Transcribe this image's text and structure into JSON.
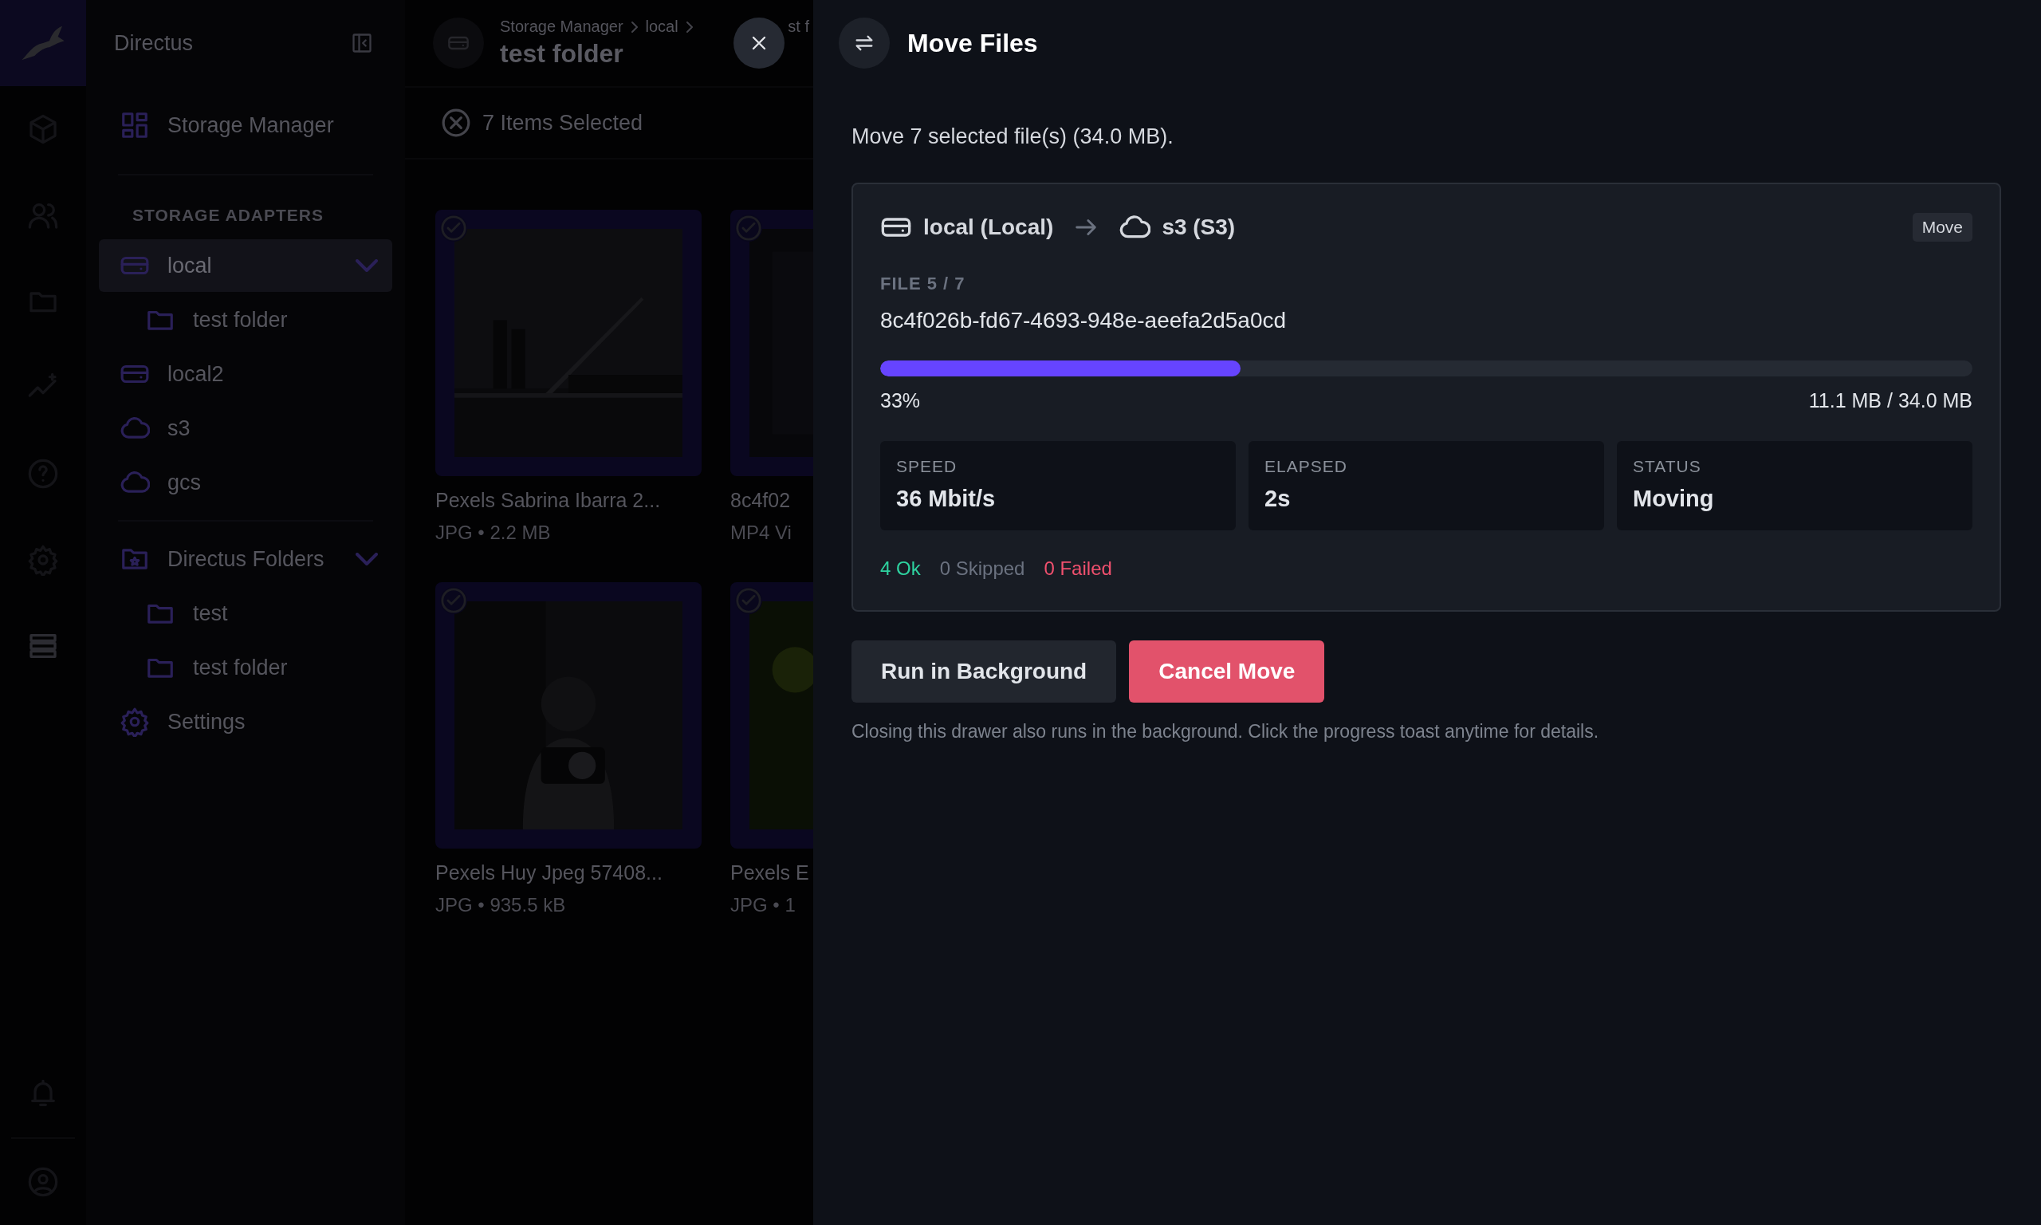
{
  "nav_rail": {
    "items": [
      {
        "selected": false
      },
      {
        "selected": false
      },
      {
        "selected": false
      },
      {
        "selected": false
      },
      {
        "selected": false
      },
      {
        "selected": false
      },
      {
        "selected": true
      }
    ],
    "bottom_items": [
      {
        "selected": false
      },
      {
        "selected": false
      }
    ]
  },
  "sidebar": {
    "title": "Directus",
    "module": {
      "label": "Storage Manager"
    },
    "adapters": {
      "heading": "STORAGE ADAPTERS",
      "items": [
        {
          "kind": "disk",
          "label": "local",
          "selected": true,
          "expanded": true,
          "children": [
            {
              "kind": "folder",
              "label": "test folder",
              "selected": false
            }
          ]
        },
        {
          "kind": "disk",
          "label": "local2",
          "selected": false
        },
        {
          "kind": "cloud",
          "label": "s3",
          "selected": false
        },
        {
          "kind": "cloud",
          "label": "gcs",
          "selected": false
        }
      ]
    },
    "folders": {
      "items": [
        {
          "kind": "starred-folder",
          "label": "Directus Folders",
          "selected": false,
          "expanded": true,
          "children": [
            {
              "kind": "folder",
              "label": "test",
              "selected": false
            },
            {
              "kind": "folder",
              "label": "test folder",
              "selected": false
            }
          ]
        }
      ]
    },
    "settings": {
      "label": "Settings"
    }
  },
  "main": {
    "breadcrumb": [
      "Storage Manager",
      "local",
      "st f"
    ],
    "title": "test folder",
    "selection": "7 Items Selected",
    "files": [
      {
        "name": "Pexels Sabrina Ibarra 2...",
        "meta": "JPG • 2.2 MB",
        "selected": true
      },
      {
        "name": "8c4f02",
        "meta": "MP4 Vi",
        "selected": true
      },
      {
        "name": "Pexels Huy Jpeg 57408...",
        "meta": "JPG • 935.5 kB",
        "selected": true
      },
      {
        "name": "Pexels E",
        "meta": "JPG • 1",
        "selected": true
      }
    ]
  },
  "drawer": {
    "title": "Move Files",
    "description": "Move 7 selected file(s) (34.0 MB).",
    "transfer": {
      "source": {
        "kind": "disk",
        "label": "local (Local)"
      },
      "target": {
        "kind": "cloud",
        "label": "s3 (S3)"
      },
      "badge": "Move",
      "file_counter": "FILE 5 / 7",
      "file_name": "8c4f026b-fd67-4693-948e-aeefa2d5a0cd",
      "progress": {
        "level": 0.33,
        "percent": "33%",
        "bytes": "11.1 MB / 34.0 MB"
      },
      "stats": [
        {
          "label": "SPEED",
          "value": "36 Mbit/s"
        },
        {
          "label": "ELAPSED",
          "value": "2s"
        },
        {
          "label": "STATUS",
          "value": "Moving"
        }
      ],
      "counts": [
        {
          "kind": "ok",
          "text": "4 Ok"
        },
        {
          "kind": "skipped",
          "text": "0 Skipped"
        },
        {
          "kind": "failed",
          "text": "0 Failed"
        }
      ]
    },
    "buttons": [
      {
        "kind": "secondary",
        "label": "Run in Background"
      },
      {
        "kind": "danger",
        "label": "Cancel Move"
      }
    ],
    "note": "Closing this drawer also runs in the background. Click the progress toast anytime for details."
  }
}
